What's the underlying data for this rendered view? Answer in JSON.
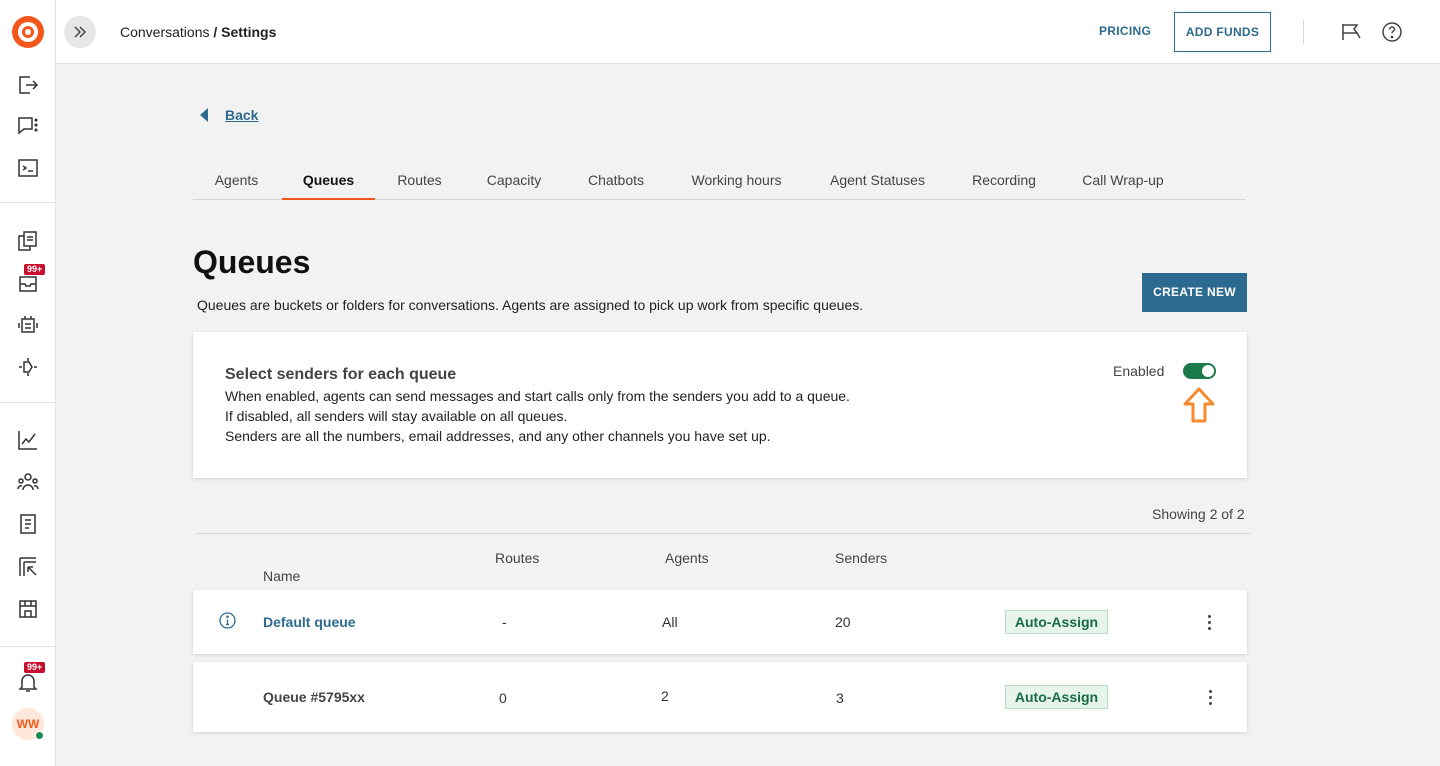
{
  "header": {
    "breadcrumb_parent": "Conversations",
    "breadcrumb_separator": " / ",
    "breadcrumb_current": "Settings",
    "pricing_label": "PRICING",
    "add_funds_label": "ADD FUNDS"
  },
  "sidebar": {
    "notifications_badge": "99+",
    "inbox_badge": "99+",
    "avatar_initials": "WW"
  },
  "back_label": "Back",
  "tabs": [
    {
      "label": "Agents"
    },
    {
      "label": "Queues"
    },
    {
      "label": "Routes"
    },
    {
      "label": "Capacity"
    },
    {
      "label": "Chatbots"
    },
    {
      "label": "Working hours"
    },
    {
      "label": "Agent Statuses"
    },
    {
      "label": "Recording"
    },
    {
      "label": "Call Wrap-up"
    }
  ],
  "active_tab": "Queues",
  "page": {
    "title": "Queues",
    "description": "Queues are buckets or folders for conversations. Agents are assigned to pick up work from specific queues.",
    "create_label": "CREATE NEW"
  },
  "senders_card": {
    "title": "Select senders for each queue",
    "lines": [
      "When enabled, agents can send messages and start calls only from the senders you add to a queue.",
      "If disabled, all senders will stay available on all queues.",
      "Senders are all the numbers, email addresses, and any other channels you have set up."
    ],
    "toggle_label": "Enabled",
    "toggle_on": true
  },
  "table": {
    "showing": "Showing 2 of 2",
    "columns": {
      "name": "Name",
      "routes": "Routes",
      "agents": "Agents",
      "senders": "Senders"
    },
    "rows": [
      {
        "name": "Default queue",
        "routes": "-",
        "agents": "All",
        "senders": "20",
        "badge": "Auto-Assign"
      },
      {
        "name": "Queue #5795xx",
        "routes": "0",
        "agents": "2",
        "senders": "3",
        "badge": "Auto-Assign"
      }
    ]
  },
  "colors": {
    "brand": "#f3571c",
    "primary": "#2c6b8f",
    "toggle_on": "#1a7a4c",
    "badge_text": "#1a6b44",
    "annotation_arrow": "#f58a2e"
  }
}
